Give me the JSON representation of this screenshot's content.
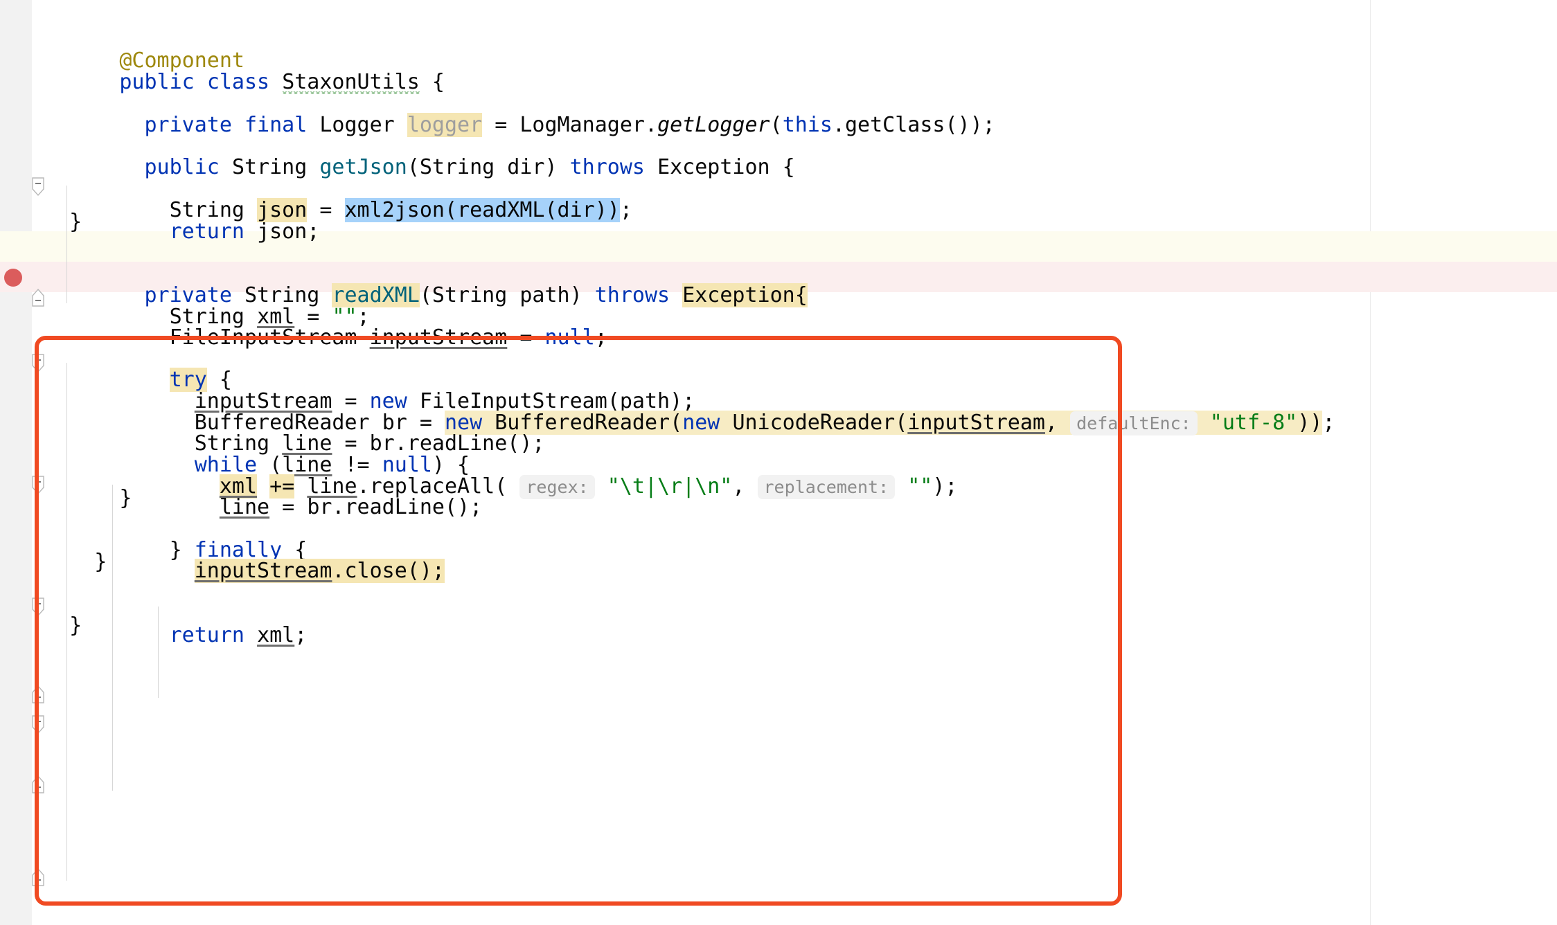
{
  "editor": {
    "language": "java",
    "file_class": "StaxonUtils",
    "theme": "IntelliJ Light",
    "colors": {
      "background": "#ffffff",
      "gutter": "#f2f2f2",
      "keyword": "#0033b3",
      "annotation": "#9e880d",
      "method_declaration": "#00627a",
      "string": "#067d17",
      "identifier_highlight": "#f5e6b3",
      "selection": "#a6d2fa",
      "caret_row": "#fdfcef",
      "exception_row": "#fbeeee",
      "breakpoint": "#db5c5c",
      "annotation_box": "#f04a22",
      "inlay_hint_text": "#8c8c8c",
      "inlay_hint_bg": "#f2f2f2"
    }
  },
  "annotation_box": {
    "name": "readXML-method-highlight-box",
    "color": "#f04a22",
    "covers": "private String readXML(String path) throws Exception { ... }"
  },
  "breakpoint": {
    "present": true,
    "on_line_text": "return json;"
  },
  "code_lines": [
    {
      "id": "l1",
      "indent": 0,
      "text": "@Component"
    },
    {
      "id": "l2",
      "indent": 0,
      "text": "public class StaxonUtils {"
    },
    {
      "id": "l3",
      "indent": 0,
      "text": ""
    },
    {
      "id": "l4",
      "indent": 1,
      "text": "private final Logger logger = LogManager.getLogger(this.getClass());"
    },
    {
      "id": "l5",
      "indent": 0,
      "text": ""
    },
    {
      "id": "l6",
      "indent": 1,
      "text": "public String getJson(String dir) throws Exception {"
    },
    {
      "id": "l7",
      "indent": 0,
      "text": ""
    },
    {
      "id": "l8",
      "indent": 2,
      "text": "String json = xml2json(readXML(dir));"
    },
    {
      "id": "l9",
      "indent": 2,
      "text": "return json;"
    },
    {
      "id": "l10",
      "indent": 1,
      "text": "}"
    },
    {
      "id": "l11",
      "indent": 0,
      "text": ""
    },
    {
      "id": "l12",
      "indent": 1,
      "text": "private String readXML(String path) throws Exception{"
    },
    {
      "id": "l13",
      "indent": 2,
      "text": "String xml = \"\";"
    },
    {
      "id": "l14",
      "indent": 2,
      "text": "FileInputStream inputStream = null;"
    },
    {
      "id": "l15",
      "indent": 0,
      "text": ""
    },
    {
      "id": "l16",
      "indent": 2,
      "text": "try {"
    },
    {
      "id": "l17",
      "indent": 3,
      "text": "inputStream = new FileInputStream(path);"
    },
    {
      "id": "l18",
      "indent": 3,
      "text": "BufferedReader br = new BufferedReader(new UnicodeReader(inputStream, defaultEnc: \"utf-8\"));"
    },
    {
      "id": "l19",
      "indent": 3,
      "text": "String line = br.readLine();"
    },
    {
      "id": "l20",
      "indent": 3,
      "text": "while (line != null) {"
    },
    {
      "id": "l21",
      "indent": 4,
      "text": "xml += line.replaceAll( regex: \"\\t|\\r|\\n\", replacement: \"\");"
    },
    {
      "id": "l22",
      "indent": 4,
      "text": "line = br.readLine();"
    },
    {
      "id": "l23",
      "indent": 3,
      "text": "}"
    },
    {
      "id": "l24",
      "indent": 2,
      "text": "} finally {"
    },
    {
      "id": "l25",
      "indent": 3,
      "text": "inputStream.close();"
    },
    {
      "id": "l26",
      "indent": 2,
      "text": "}"
    },
    {
      "id": "l27",
      "indent": 0,
      "text": ""
    },
    {
      "id": "l28",
      "indent": 2,
      "text": "return xml;"
    },
    {
      "id": "l29",
      "indent": 1,
      "text": "}"
    }
  ],
  "tokens": {
    "anno_component": "@Component",
    "kw_public": "public",
    "kw_class": "class",
    "kw_private": "private",
    "kw_final": "final",
    "kw_throws": "throws",
    "kw_return": "return",
    "kw_new": "new",
    "kw_null": "null",
    "kw_try": "try",
    "kw_finally": "finally",
    "kw_while": "while",
    "kw_this": "this",
    "t_class_name": "StaxonUtils",
    "t_logger_type": "Logger",
    "t_logger_var": "logger",
    "t_logmanager": "LogManager.",
    "t_getlogger": "getLogger",
    "t_getclass": ".getClass());",
    "t_string": "String",
    "t_getjson": "getJson",
    "t_json": "json",
    "t_xml2json_sel": "xml2json(readXML(dir))",
    "t_readxml": "readXML",
    "t_exception": "Exception",
    "t_exception_brace": "Exception{",
    "t_path_param": "(String path) ",
    "t_dir_param": "(String dir) ",
    "t_xml": "xml",
    "t_empty_string": "\"\"",
    "t_fileinputstream": "FileInputStream",
    "t_inputstream": "inputStream",
    "t_bufferedreader": "BufferedReader",
    "t_br": "br",
    "t_unicodereader": "UnicodeReader",
    "t_line": "line",
    "t_readline": "br.readLine();",
    "t_replaceall": ".replaceAll(",
    "t_plus_eq": "+=",
    "t_close": ".close();",
    "t_utf8": "\"utf-8\"",
    "t_regex_value": "\"\\t|\\r|\\n\"",
    "t_replacement_value": "\"\"",
    "hint_defaultenc": "defaultEnc:",
    "hint_regex": "regex:",
    "hint_replacement": "replacement:"
  }
}
